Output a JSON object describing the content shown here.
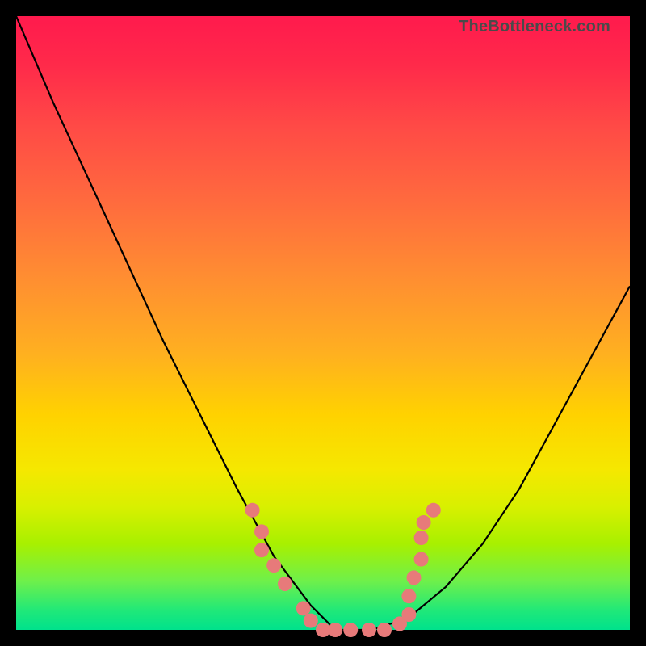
{
  "watermark": "TheBottleneck.com",
  "chart_data": {
    "type": "line",
    "title": "",
    "xlabel": "",
    "ylabel": "",
    "xlim": [
      0,
      1
    ],
    "ylim": [
      0,
      1
    ],
    "series": [
      {
        "name": "curve",
        "x": [
          0.0,
          0.06,
          0.12,
          0.18,
          0.24,
          0.3,
          0.36,
          0.42,
          0.48,
          0.52,
          0.58,
          0.64,
          0.7,
          0.76,
          0.82,
          0.88,
          0.94,
          1.0
        ],
        "y": [
          1.0,
          0.86,
          0.73,
          0.6,
          0.47,
          0.35,
          0.23,
          0.12,
          0.04,
          0.0,
          0.0,
          0.02,
          0.07,
          0.14,
          0.23,
          0.34,
          0.45,
          0.56
        ]
      }
    ],
    "markers": [
      {
        "x": 0.385,
        "y": 0.195
      },
      {
        "x": 0.4,
        "y": 0.16
      },
      {
        "x": 0.4,
        "y": 0.13
      },
      {
        "x": 0.42,
        "y": 0.105
      },
      {
        "x": 0.438,
        "y": 0.075
      },
      {
        "x": 0.468,
        "y": 0.035
      },
      {
        "x": 0.48,
        "y": 0.015
      },
      {
        "x": 0.5,
        "y": 0.0
      },
      {
        "x": 0.52,
        "y": 0.0
      },
      {
        "x": 0.545,
        "y": 0.0
      },
      {
        "x": 0.575,
        "y": 0.0
      },
      {
        "x": 0.6,
        "y": 0.0
      },
      {
        "x": 0.625,
        "y": 0.01
      },
      {
        "x": 0.64,
        "y": 0.025
      },
      {
        "x": 0.64,
        "y": 0.055
      },
      {
        "x": 0.648,
        "y": 0.085
      },
      {
        "x": 0.66,
        "y": 0.115
      },
      {
        "x": 0.66,
        "y": 0.15
      },
      {
        "x": 0.664,
        "y": 0.175
      },
      {
        "x": 0.68,
        "y": 0.195
      }
    ],
    "marker_color": "#e77a7a",
    "curve_color": "#000000",
    "background_gradient": [
      "#ff1a4d",
      "#ffd200",
      "#00e28c"
    ]
  }
}
